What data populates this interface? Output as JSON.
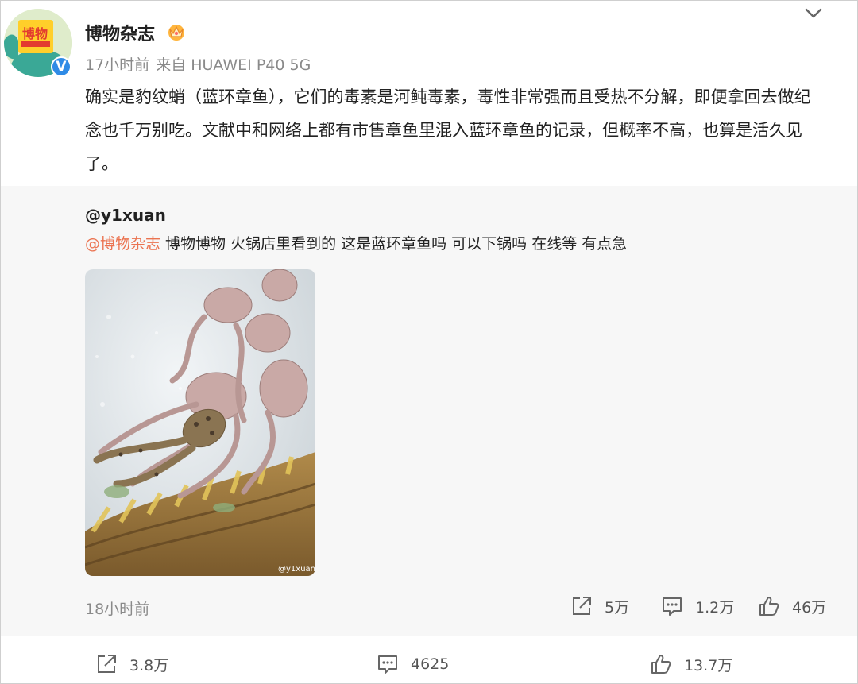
{
  "post": {
    "author": "博物杂志",
    "time": "17小时前",
    "source": "来自 HUAWEI P40 5G",
    "avatar_text": "博物",
    "verified_mark": "V",
    "text": "确实是豹纹蛸（蓝环章鱼），它们的毒素是河鲀毒素，毒性非常强而且受热不分解，即便拿回去做纪念也千万别吃。文献中和网络上都有市售章鱼里混入蓝环章鱼的记录，但概率不高，也算是活久见了。"
  },
  "repost": {
    "user": "@y1xuan",
    "mention": "@博物杂志",
    "text": " 博物博物 火锅店里看到的 这是蓝环章鱼吗 可以下锅吗 在线等 有点急",
    "image_watermark": "@y1xuan",
    "time": "18小时前",
    "share_count": "5万",
    "comment_count": "1.2万",
    "like_count": "46万"
  },
  "footer": {
    "share_count": "3.8万",
    "comment_count": "4625",
    "like_count": "13.7万"
  },
  "icons": {
    "share": "share-icon",
    "comment": "comment-icon",
    "like": "thumbs-up-icon",
    "more": "chevron-down-icon",
    "badge": "crown-icon"
  },
  "colors": {
    "mention": "#eb7350",
    "verified": "#2f8be6",
    "meta": "#8a8a8a",
    "repost_bg": "#f7f7f7"
  }
}
